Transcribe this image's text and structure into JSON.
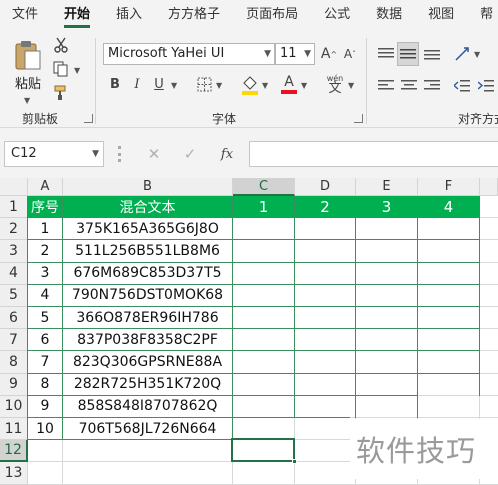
{
  "ribbon_tabs": [
    "文件",
    "开始",
    "插入",
    "方方格子",
    "页面布局",
    "公式",
    "数据",
    "视图",
    "帮"
  ],
  "active_tab": "开始",
  "clipboard": {
    "paste_label": "粘贴",
    "group_label": "剪贴板"
  },
  "font": {
    "name": "Microsoft YaHei UI",
    "size": "11",
    "group_label": "字体",
    "bold": "B",
    "italic": "I",
    "underline": "U",
    "wen_label": "wén",
    "wen_char": "文"
  },
  "alignment": {
    "group_label": "对齐方式"
  },
  "formula_bar": {
    "name_box": "C12",
    "cancel": "✕",
    "enter": "✓",
    "fx": "fx",
    "value": ""
  },
  "columns": [
    "A",
    "B",
    "C",
    "D",
    "E",
    "F"
  ],
  "rows": [
    "1",
    "2",
    "3",
    "4",
    "5",
    "6",
    "7",
    "8",
    "9",
    "10",
    "11",
    "12",
    "13"
  ],
  "header_row": [
    "序号",
    "混合文本",
    "1",
    "2",
    "3",
    "4"
  ],
  "data_rows": [
    [
      "1",
      "375K165A365G6J8O"
    ],
    [
      "2",
      "511L256B551LB8M6"
    ],
    [
      "3",
      "676M689C853D37T5"
    ],
    [
      "4",
      "790N756DST0MOK68"
    ],
    [
      "5",
      "366O878ER96IH786"
    ],
    [
      "6",
      "837P038F8358C2PF"
    ],
    [
      "7",
      "823Q306GPSRNE88A"
    ],
    [
      "8",
      "282R725H351K720Q"
    ],
    [
      "9",
      "858S848I8707862Q"
    ],
    [
      "10",
      "706T568JL726N664"
    ]
  ],
  "selected_cell": "C12",
  "watermark": "软件技巧",
  "colors": {
    "header_fill": "#00B050",
    "accent": "#217346"
  }
}
